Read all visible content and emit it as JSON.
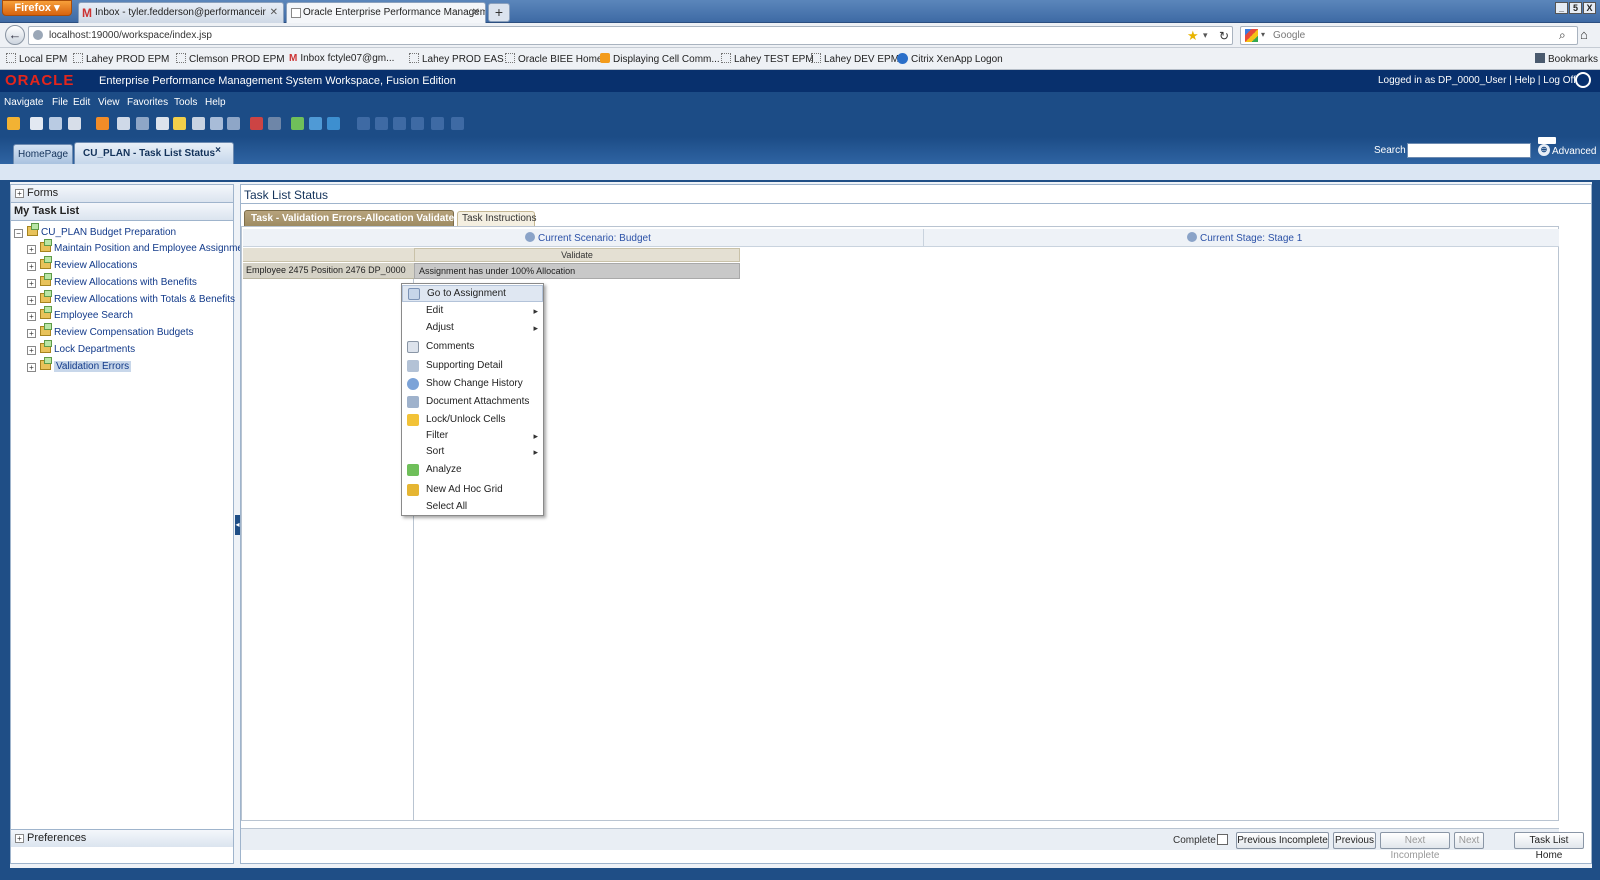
{
  "browser": {
    "menu_button": "Firefox",
    "tabs": [
      {
        "label": "Inbox - tyler.fedderson@performanceir"
      },
      {
        "label": "Oracle Enterprise Performance Managem"
      }
    ],
    "new_tab": "+",
    "url": "localhost:19000/workspace/index.jsp",
    "search_placeholder": "Google",
    "bookmarks": [
      "Local EPM",
      "Lahey PROD EPM",
      "Clemson PROD EPM",
      "Inbox fctyle07@gm...",
      "Lahey PROD EAS",
      "Oracle BIEE Home",
      "Displaying Cell Comm...",
      "Lahey TEST EPM",
      "Lahey DEV EPM",
      "Citrix XenApp Logon"
    ],
    "bookmarks_menu": "Bookmarks",
    "window_controls": [
      "_",
      "5",
      "X"
    ]
  },
  "app": {
    "logo": "ORACLE",
    "title": "Enterprise Performance Management System Workspace, Fusion Edition",
    "user_info": "Logged in as DP_0000_User  |  Help  |  Log Off",
    "menus": [
      "Navigate",
      "File",
      "Edit",
      "View",
      "Favorites",
      "Tools",
      "Help"
    ],
    "tabs": {
      "home": "HomePage",
      "current": "CU_PLAN - Task List Status",
      "close": "×"
    },
    "search_label": "Search",
    "search_value": "",
    "advanced_label": "Advanced",
    "colors": {
      "header": "#08306d",
      "bar": "#1c4c86",
      "logo_red": "#e4261c"
    }
  },
  "left_panel": {
    "forms_label": "Forms",
    "my_task_list_label": "My Task List",
    "root": "CU_PLAN Budget Preparation",
    "items": [
      {
        "label": "Maintain Position and Employee Assignments"
      },
      {
        "label": "Review Allocations"
      },
      {
        "label": "Review Allocations with Benefits"
      },
      {
        "label": "Review Allocations with Totals & Benefits"
      },
      {
        "label": "Employee Search"
      },
      {
        "label": "Review Compensation Budgets"
      },
      {
        "label": "Lock Departments"
      },
      {
        "label": "Validation Errors"
      }
    ],
    "preferences_label": "Preferences"
  },
  "right_panel": {
    "title": "Task List Status",
    "tabs": [
      "Task - Validation Errors-Allocation Validate",
      "Task Instructions"
    ],
    "pov": {
      "scenario": "Current Scenario: Budget",
      "stage": "Current Stage: Stage 1"
    },
    "grid": {
      "column_header": "Validate",
      "row_header": "Employee 2475   Position 2476   DP_0000",
      "cell": "Assignment has under 100% Allocation"
    },
    "footer": {
      "complete_label": "Complete",
      "complete_checked": false,
      "buttons": {
        "previous_incomplete": "Previous Incomplete",
        "previous": "Previous",
        "next_incomplete": "Next Incomplete",
        "next": "Next",
        "task_list_home": "Task List Home"
      }
    }
  },
  "context_menu": {
    "items": [
      {
        "label": "Go to Assignment",
        "icon": "go-to-icon",
        "highlighted": true
      },
      {
        "label": "Edit",
        "submenu": true
      },
      {
        "label": "Adjust",
        "submenu": true
      },
      {
        "label": "Comments",
        "icon": "comments-icon"
      },
      {
        "label": "Supporting Detail",
        "icon": "supporting-detail-icon"
      },
      {
        "label": "Show Change History",
        "icon": "history-icon"
      },
      {
        "label": "Document Attachments",
        "icon": "attachment-icon"
      },
      {
        "label": "Lock/Unlock Cells",
        "icon": "lock-icon"
      },
      {
        "label": "Filter",
        "submenu": true
      },
      {
        "label": "Sort",
        "submenu": true
      },
      {
        "label": "Analyze",
        "icon": "analyze-icon"
      },
      {
        "label": "New Ad Hoc Grid",
        "icon": "adhoc-icon"
      },
      {
        "label": "Select All"
      }
    ],
    "submenu_arrow": "▸"
  }
}
